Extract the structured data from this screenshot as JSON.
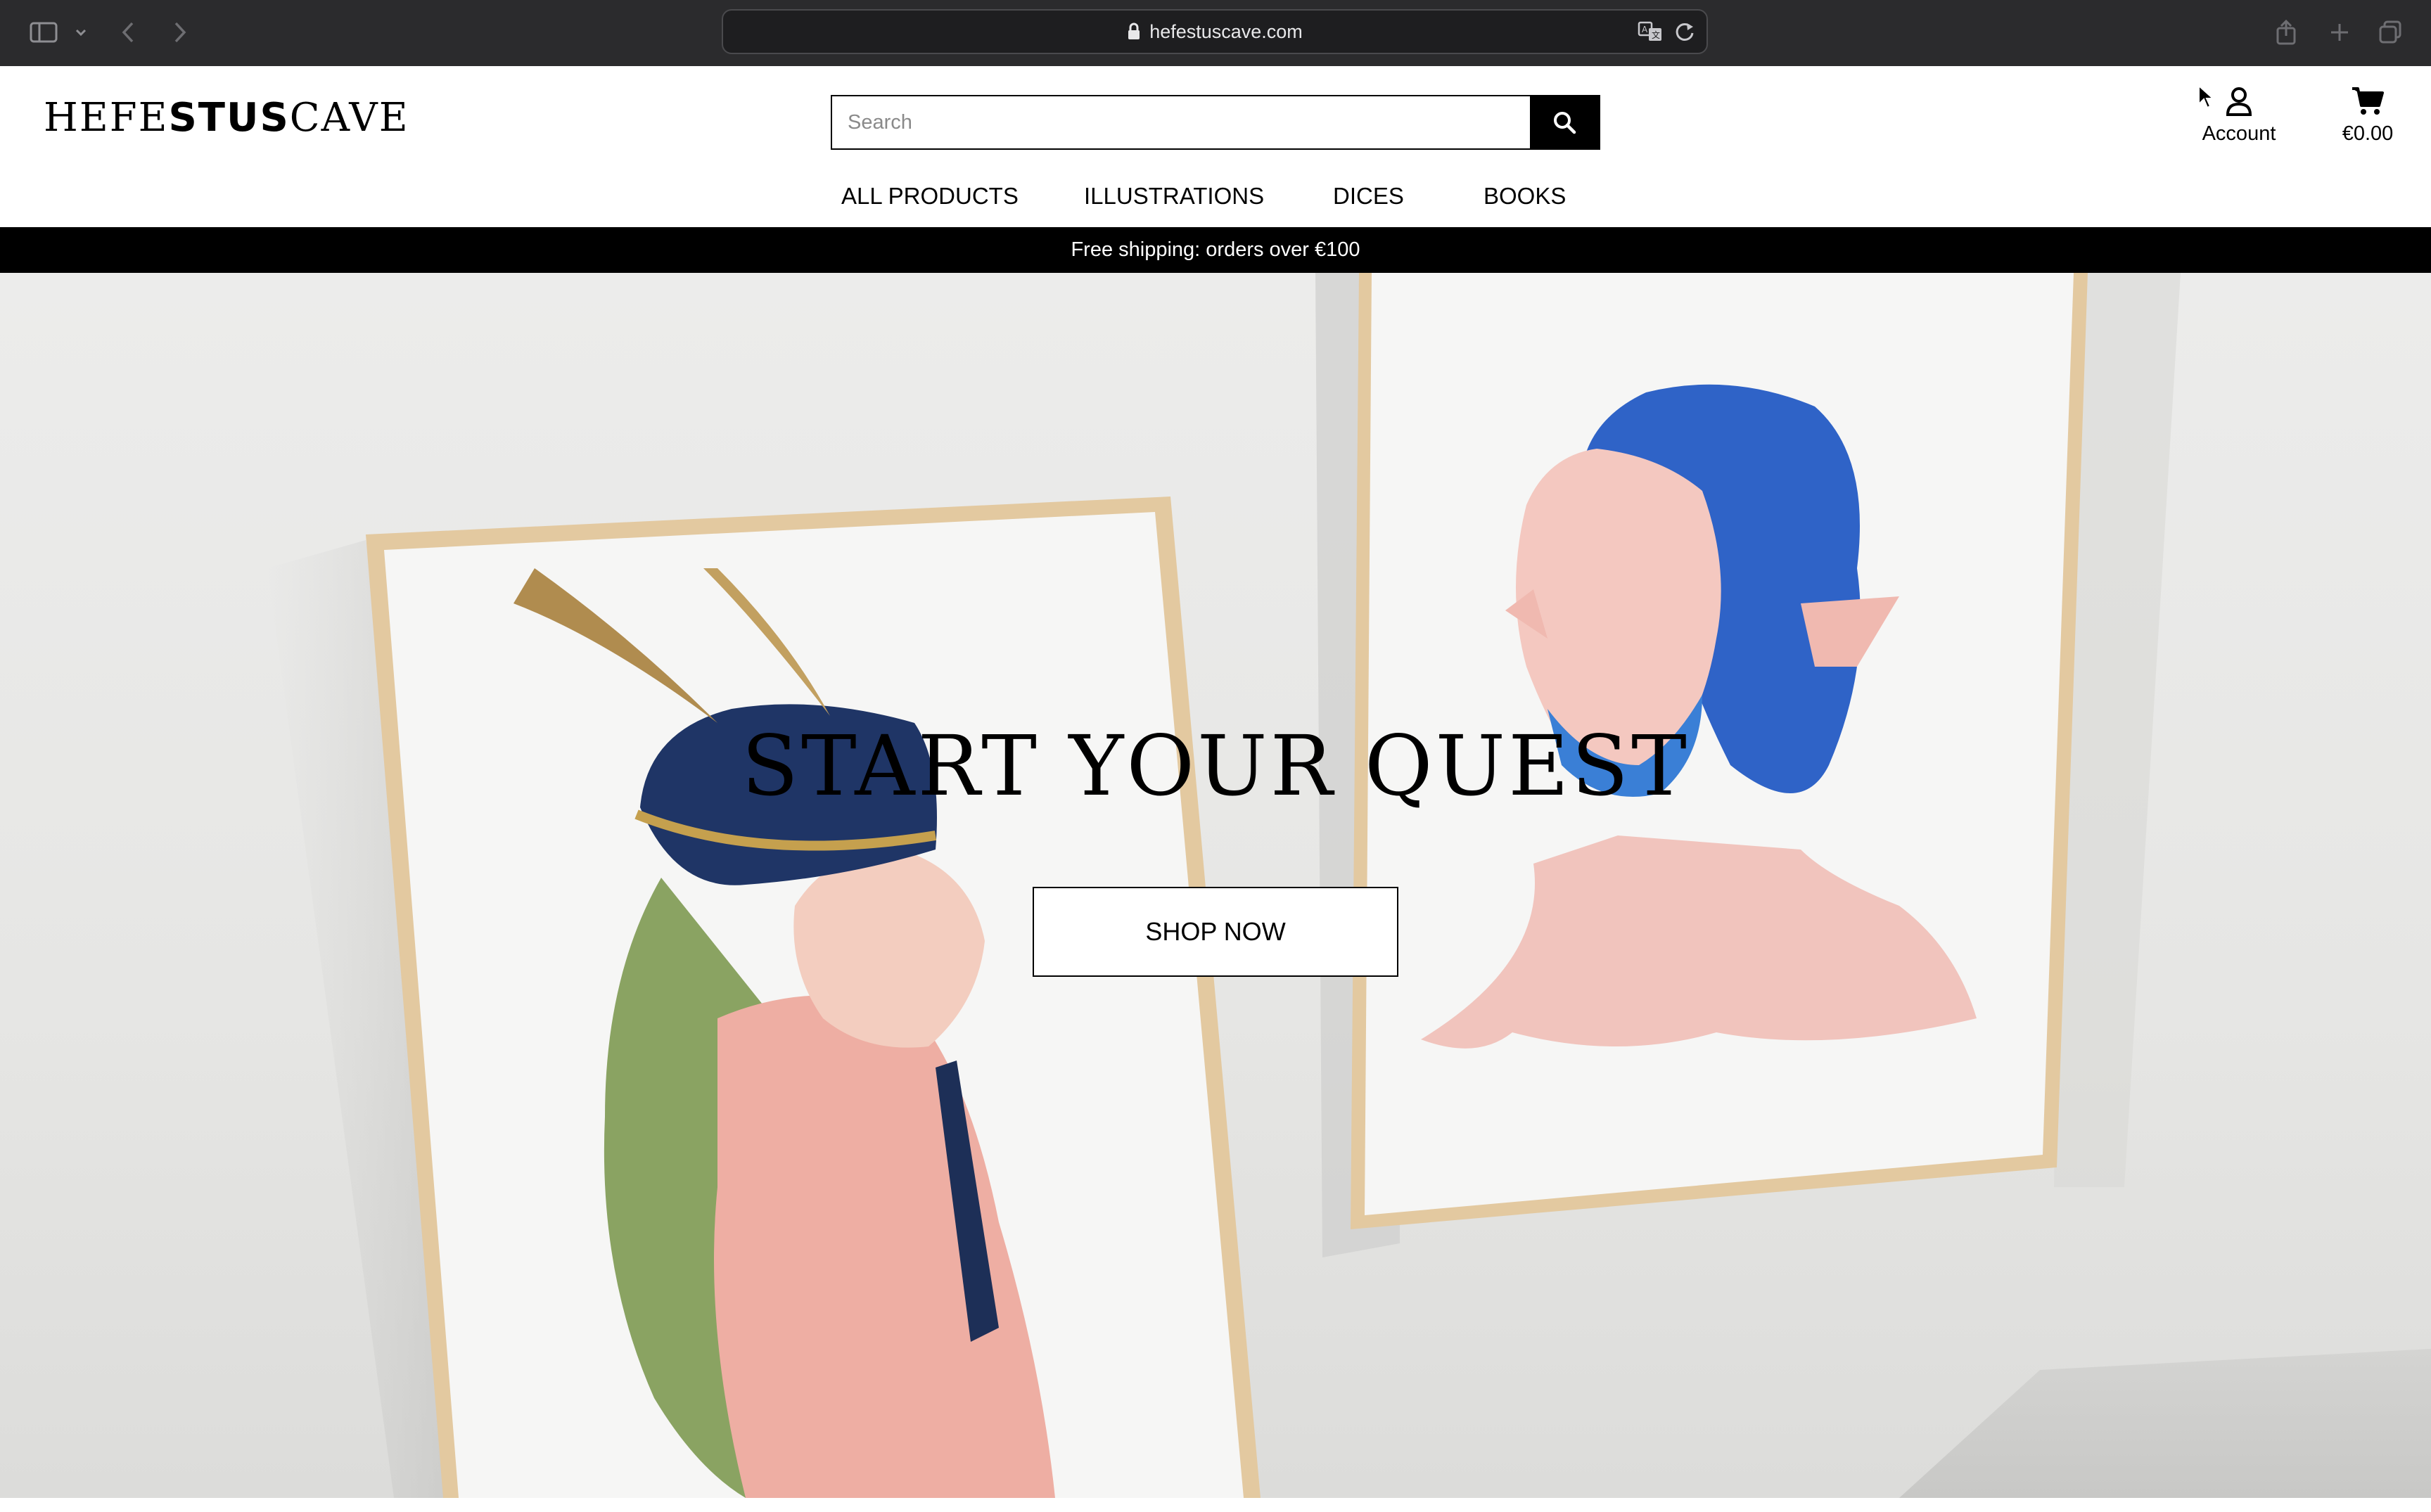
{
  "browser": {
    "url": "hefestuscave.com",
    "icons": [
      "sidebar-icon",
      "chevron-down-icon",
      "back-icon",
      "forward-icon",
      "lock-icon",
      "translate-icon",
      "reload-icon",
      "share-icon",
      "new-tab-icon",
      "tabs-overview-icon"
    ]
  },
  "header": {
    "logo_parts": [
      "HEFE",
      "STUS",
      "CAVE"
    ],
    "search_placeholder": "Search",
    "account_label": "Account",
    "cart_total": "€0.00"
  },
  "nav": {
    "items": [
      "ALL PRODUCTS",
      "ILLUSTRATIONS",
      "DICES",
      "BOOKS"
    ]
  },
  "announcement": "Free shipping: orders over €100",
  "hero": {
    "title": "START YOUR QUEST",
    "cta_label": "SHOP NOW"
  },
  "colors": {
    "chrome": "#2b2b2d",
    "accent": "#000000",
    "background": "#ffffff"
  }
}
